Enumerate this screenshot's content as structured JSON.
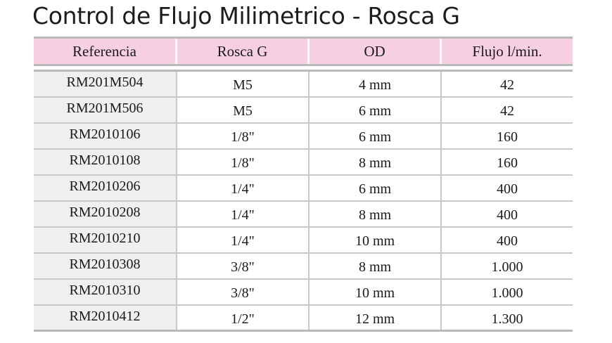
{
  "title": "Control de Flujo Milimetrico - Rosca G",
  "table": {
    "headers": [
      "Referencia",
      "Rosca G",
      "OD",
      "Flujo l/min."
    ],
    "rows": [
      [
        "RM201M504",
        "M5",
        "4 mm",
        "42"
      ],
      [
        "RM201M506",
        "M5",
        "6 mm",
        "42"
      ],
      [
        "RM2010106",
        "1/8\"",
        "6 mm",
        "160"
      ],
      [
        "RM2010108",
        "1/8\"",
        "8 mm",
        "160"
      ],
      [
        "RM2010206",
        "1/4\"",
        "6 mm",
        "400"
      ],
      [
        "RM2010208",
        "1/4\"",
        "8 mm",
        "400"
      ],
      [
        "RM2010210",
        "1/4\"",
        "10 mm",
        "400"
      ],
      [
        "RM2010308",
        "3/8\"",
        "8 mm",
        "1.000"
      ],
      [
        "RM2010310",
        "3/8\"",
        "10 mm",
        "1.000"
      ],
      [
        "RM2010412",
        "1/2\"",
        "12 mm",
        "1.300"
      ]
    ]
  },
  "colors": {
    "header_background": "#f6cfe0",
    "reference_column_background": "#efefef",
    "rule_color": "#b9b9b9"
  }
}
